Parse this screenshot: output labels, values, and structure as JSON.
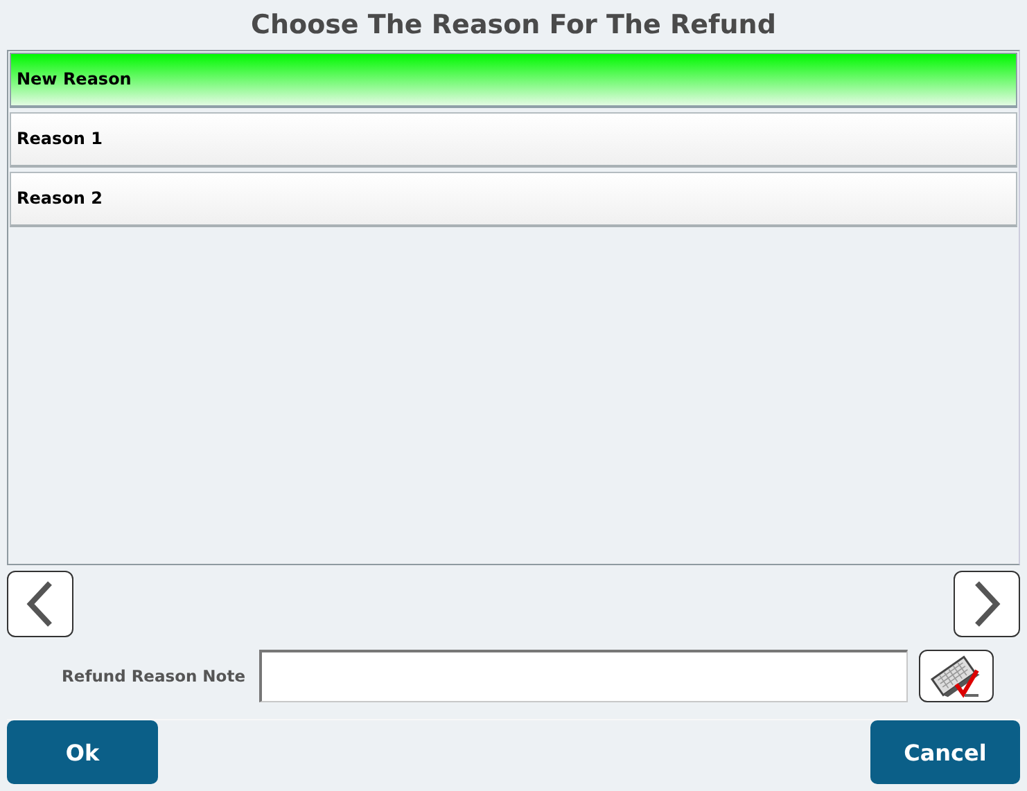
{
  "title": "Choose The Reason For The Refund",
  "reasons": [
    {
      "label": "New Reason",
      "selected": true
    },
    {
      "label": "Reason 1",
      "selected": false
    },
    {
      "label": "Reason 2",
      "selected": false
    }
  ],
  "note": {
    "label": "Refund Reason Note"
  },
  "buttons": {
    "ok": "Ok",
    "cancel": "Cancel"
  }
}
